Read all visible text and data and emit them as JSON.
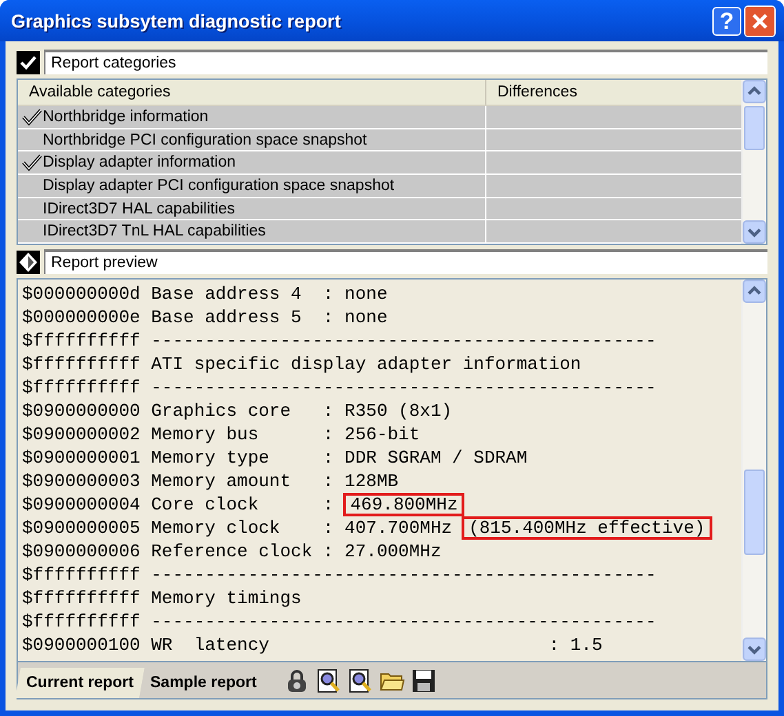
{
  "window": {
    "title": "Graphics subsytem diagnostic report",
    "help_button": "?"
  },
  "categories_section": {
    "title": "Report categories",
    "checked": true
  },
  "categories_table": {
    "columns": [
      "Available categories",
      "Differences"
    ],
    "rows": [
      {
        "name": "Northbridge information",
        "checked": true
      },
      {
        "name": "Northbridge PCI configuration space snapshot",
        "checked": false
      },
      {
        "name": "Display adapter information",
        "checked": true
      },
      {
        "name": "Display adapter PCI configuration space snapshot",
        "checked": false
      },
      {
        "name": "IDirect3D7 HAL capabilities",
        "checked": false
      },
      {
        "name": "IDirect3D7 TnL HAL capabilities",
        "checked": false
      }
    ]
  },
  "preview_section": {
    "title": "Report preview"
  },
  "report_lines": [
    {
      "parts": [
        {
          "text": "$000000000d Base address 4  : none",
          "boxed": false
        }
      ]
    },
    {
      "parts": [
        {
          "text": "$000000000e Base address 5  : none",
          "boxed": false
        }
      ]
    },
    {
      "parts": [
        {
          "text": "$ffffffffff -----------------------------------------------",
          "boxed": false
        }
      ]
    },
    {
      "parts": [
        {
          "text": "$ffffffffff ATI specific display adapter information",
          "boxed": false
        }
      ]
    },
    {
      "parts": [
        {
          "text": "$ffffffffff -----------------------------------------------",
          "boxed": false
        }
      ]
    },
    {
      "parts": [
        {
          "text": "$0900000000 Graphics core   : R350 (8x1)",
          "boxed": false
        }
      ]
    },
    {
      "parts": [
        {
          "text": "$0900000002 Memory bus      : 256-bit",
          "boxed": false
        }
      ]
    },
    {
      "parts": [
        {
          "text": "$0900000001 Memory type     : DDR SGRAM / SDRAM",
          "boxed": false
        }
      ]
    },
    {
      "parts": [
        {
          "text": "$0900000003 Memory amount   : 128MB",
          "boxed": false
        }
      ]
    },
    {
      "parts": [
        {
          "text": "$0900000004 Core clock      :",
          "boxed": false
        },
        {
          "text": "469.800MHz",
          "boxed": true
        }
      ]
    },
    {
      "parts": [
        {
          "text": "$0900000005 Memory clock    : 407.700MHz",
          "boxed": false
        },
        {
          "text": "(815.400MHz effective)",
          "boxed": true
        }
      ]
    },
    {
      "parts": [
        {
          "text": "$0900000006 Reference clock : 27.000MHz",
          "boxed": false
        }
      ]
    },
    {
      "parts": [
        {
          "text": "$ffffffffff -----------------------------------------------",
          "boxed": false
        }
      ]
    },
    {
      "parts": [
        {
          "text": "$ffffffffff Memory timings",
          "boxed": false
        }
      ]
    },
    {
      "parts": [
        {
          "text": "$ffffffffff -----------------------------------------------",
          "boxed": false
        }
      ]
    },
    {
      "parts": [
        {
          "text": "$0900000100 WR  latency                          : 1.5",
          "boxed": false
        }
      ]
    }
  ],
  "report_tabs": [
    {
      "label": "Current report",
      "selected": true
    },
    {
      "label": "Sample report",
      "selected": false
    }
  ]
}
